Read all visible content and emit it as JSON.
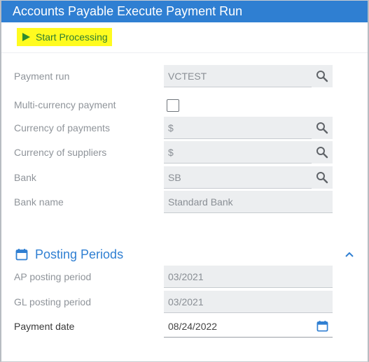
{
  "window": {
    "title": "Accounts Payable Execute Payment Run"
  },
  "toolbar": {
    "start_label": "Start Processing"
  },
  "fields": {
    "payment_run": {
      "label": "Payment run",
      "value": "VCTEST"
    },
    "multi_currency": {
      "label": "Multi-currency payment",
      "checked": false
    },
    "currency_payments": {
      "label": "Currency of payments",
      "value": "$"
    },
    "currency_suppliers": {
      "label": "Currency of suppliers",
      "value": "$"
    },
    "bank": {
      "label": "Bank",
      "value": "SB"
    },
    "bank_name": {
      "label": "Bank name",
      "value": "Standard Bank"
    }
  },
  "posting_periods": {
    "title": "Posting Periods",
    "ap_period": {
      "label": "AP posting period",
      "value": "03/2021"
    },
    "gl_period": {
      "label": "GL posting period",
      "value": "03/2021"
    },
    "payment_date": {
      "label": "Payment date",
      "value": "08/24/2022"
    }
  },
  "colors": {
    "titlebar": "#2f7fd2",
    "highlight": "#fffb1f",
    "start_text": "#2e7d32",
    "accent": "#2f7fd2"
  },
  "icons": {
    "play": "play-icon",
    "lookup": "search-icon",
    "calendar": "calendar-icon",
    "collapse": "chevron-up-icon"
  }
}
